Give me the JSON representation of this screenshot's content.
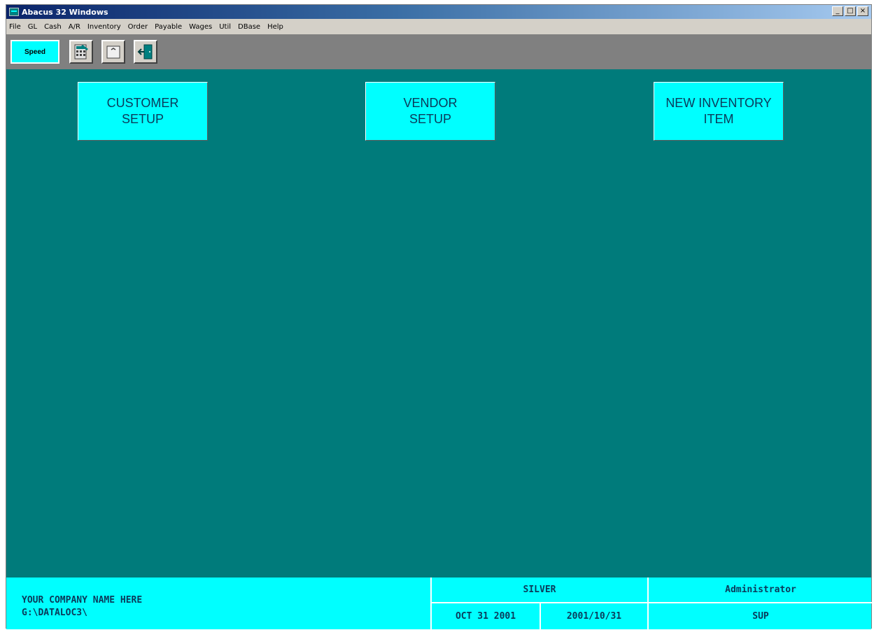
{
  "window": {
    "title": "Abacus 32 Windows",
    "controls": [
      "_",
      "□",
      "×"
    ]
  },
  "menu": {
    "items": [
      "File",
      "GL",
      "Cash",
      "A/R",
      "Inventory",
      "Order",
      "Payable",
      "Wages",
      "Util",
      "DBase",
      "Help"
    ]
  },
  "toolbar": {
    "speed_label": "Speed",
    "icons": [
      "calculator-icon",
      "folder-icon",
      "exit-door-icon"
    ]
  },
  "buttons": {
    "customer": {
      "line1": "CUSTOMER",
      "line2": "SETUP"
    },
    "vendor": {
      "line1": "VENDOR",
      "line2": "SETUP"
    },
    "inventory": {
      "line1": "NEW INVENTORY",
      "line2": "ITEM"
    }
  },
  "status": {
    "company_name": "YOUR COMPANY NAME HERE",
    "data_path": "G:\\DATALOC3\\",
    "edition": "SILVER",
    "user": "Administrator",
    "date_long": "OCT 31 2001",
    "date_iso": "2001/10/31",
    "user_code": "SUP"
  },
  "colors": {
    "main_bg": "#007b7b",
    "accent": "#00ffff",
    "text_dark": "#0b3a5a"
  }
}
